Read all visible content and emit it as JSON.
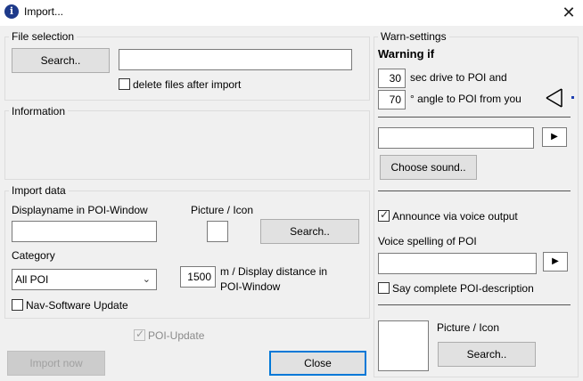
{
  "window": {
    "title": "Import...",
    "app_icon_glyph": "i"
  },
  "file_selection": {
    "legend": "File selection",
    "search_label": "Search..",
    "path_value": "",
    "delete_label": "delete files after import",
    "delete_checked": false
  },
  "information": {
    "legend": "Information"
  },
  "import_data": {
    "legend": "Import data",
    "displayname_label": "Displayname in POI-Window",
    "displayname_value": "",
    "picture_label": "Picture / Icon",
    "search_label": "Search..",
    "category_label": "Category",
    "category_value": "All POI",
    "distance_value": "1500",
    "distance_label_line1": "m / Display distance in",
    "distance_label_line2": "POI-Window",
    "nav_update_label": "Nav-Software Update",
    "nav_update_checked": false
  },
  "poi_update": {
    "label": "POI-Update",
    "checked": true,
    "disabled": true
  },
  "buttons": {
    "import_now": "Import now",
    "close": "Close"
  },
  "warn": {
    "legend": "Warn-settings",
    "warning_if": "Warning if",
    "sec_value": "30",
    "sec_label": "sec drive to POI and",
    "angle_value": "70",
    "angle_label": "° angle to POI from you",
    "sound_value": "",
    "choose_sound": "Choose sound..",
    "announce_label": "Announce via voice output",
    "announce_checked": true,
    "voice_spelling_label": "Voice spelling of POI",
    "voice_spelling_value": "",
    "say_complete_label": "Say complete POI-description",
    "say_complete_checked": false,
    "picture_label": "Picture / Icon",
    "search_label": "Search..",
    "play_glyph": "▶"
  },
  "colors": {
    "default_button_border": "#0078d7",
    "app_icon": "#1e3a8a",
    "indicator_dot": "#1f3fb0"
  }
}
